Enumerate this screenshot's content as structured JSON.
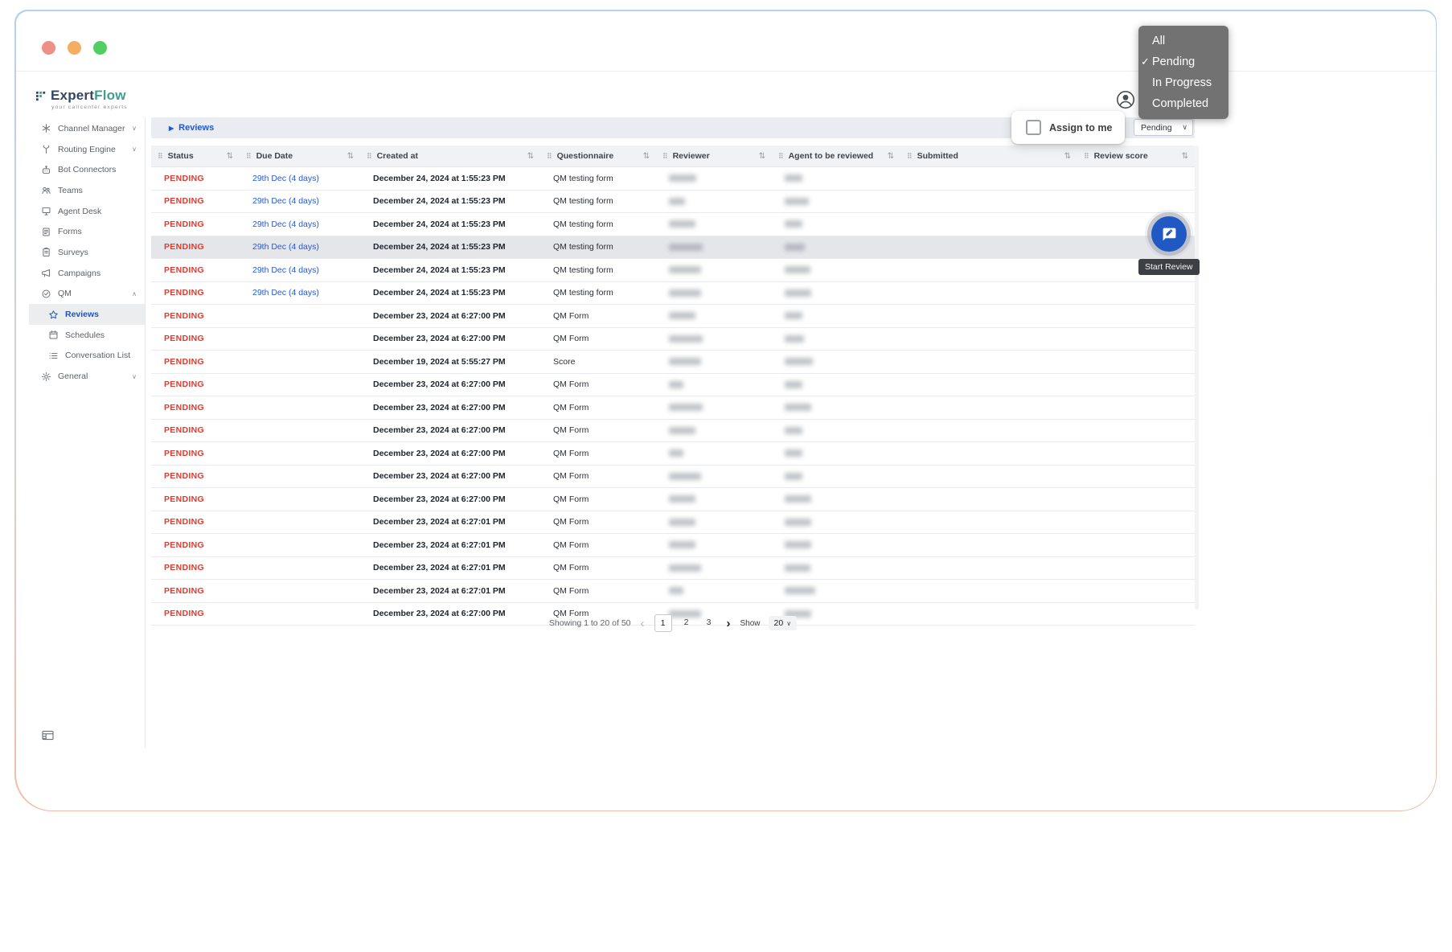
{
  "window": {
    "traffic_lights": [
      "close",
      "minimize",
      "zoom"
    ]
  },
  "brand": {
    "name_part1": "Expert",
    "name_part2": "Flow",
    "tagline": "your callcenter experts"
  },
  "sidebar": {
    "items": [
      {
        "label": "Channel Manager",
        "icon": "channel-manager",
        "chevron": "down"
      },
      {
        "label": "Routing Engine",
        "icon": "routing-engine",
        "chevron": "down"
      },
      {
        "label": "Bot Connectors",
        "icon": "bot-connectors"
      },
      {
        "label": "Teams",
        "icon": "teams"
      },
      {
        "label": "Agent Desk",
        "icon": "agent-desk"
      },
      {
        "label": "Forms",
        "icon": "forms"
      },
      {
        "label": "Surveys",
        "icon": "surveys"
      },
      {
        "label": "Campaigns",
        "icon": "campaigns"
      },
      {
        "label": "QM",
        "icon": "qm",
        "chevron": "up"
      },
      {
        "label": "Reviews",
        "icon": "reviews",
        "child": true,
        "active": true
      },
      {
        "label": "Schedules",
        "icon": "schedules",
        "child": true
      },
      {
        "label": "Conversation List",
        "icon": "conversation-list",
        "child": true
      },
      {
        "label": "General",
        "icon": "general",
        "chevron": "down"
      }
    ]
  },
  "toolbar": {
    "breadcrumb": "Reviews",
    "assign_to_me_label": "Assign to me",
    "status_filter_value": "Pending"
  },
  "filter_menu": {
    "items": [
      {
        "label": "All",
        "checked": false
      },
      {
        "label": "Pending",
        "checked": true
      },
      {
        "label": "In Progress",
        "checked": false
      },
      {
        "label": "Completed",
        "checked": false
      }
    ]
  },
  "table": {
    "columns": [
      "Status",
      "Due Date",
      "Created at",
      "Questionnaire",
      "Reviewer",
      "Agent to be reviewed",
      "Submitted",
      "Review score"
    ],
    "rows": [
      {
        "status": "PENDING",
        "due": "29th Dec (4 days)",
        "created": "December 24, 2024 at 1:55:23 PM",
        "form": "QM testing form",
        "reviewer_w": 34,
        "agent_w": 22
      },
      {
        "status": "PENDING",
        "due": "29th Dec (4 days)",
        "created": "December 24, 2024 at 1:55:23 PM",
        "form": "QM testing form",
        "reviewer_w": 20,
        "agent_w": 30
      },
      {
        "status": "PENDING",
        "due": "29th Dec (4 days)",
        "created": "December 24, 2024 at 1:55:23 PM",
        "form": "QM testing form",
        "reviewer_w": 33,
        "agent_w": 22
      },
      {
        "status": "PENDING",
        "due": "29th Dec (4 days)",
        "created": "December 24, 2024 at 1:55:23 PM",
        "form": "QM testing form",
        "reviewer_w": 42,
        "agent_w": 25,
        "highlighted": true
      },
      {
        "status": "PENDING",
        "due": "29th Dec (4 days)",
        "created": "December 24, 2024 at 1:55:23 PM",
        "form": "QM testing form",
        "reviewer_w": 40,
        "agent_w": 32
      },
      {
        "status": "PENDING",
        "due": "29th Dec (4 days)",
        "created": "December 24, 2024 at 1:55:23 PM",
        "form": "QM testing form",
        "reviewer_w": 40,
        "agent_w": 33
      },
      {
        "status": "PENDING",
        "due": "",
        "created": "December 23, 2024 at 6:27:00 PM",
        "form": "QM Form",
        "reviewer_w": 33,
        "agent_w": 22
      },
      {
        "status": "PENDING",
        "due": "",
        "created": "December 23, 2024 at 6:27:00 PM",
        "form": "QM Form",
        "reviewer_w": 42,
        "agent_w": 24
      },
      {
        "status": "PENDING",
        "due": "",
        "created": "December 19, 2024 at 5:55:27 PM",
        "form": "Score",
        "reviewer_w": 40,
        "agent_w": 35
      },
      {
        "status": "PENDING",
        "due": "",
        "created": "December 23, 2024 at 6:27:00 PM",
        "form": "QM Form",
        "reviewer_w": 18,
        "agent_w": 22
      },
      {
        "status": "PENDING",
        "due": "",
        "created": "December 23, 2024 at 6:27:00 PM",
        "form": "QM Form",
        "reviewer_w": 42,
        "agent_w": 33
      },
      {
        "status": "PENDING",
        "due": "",
        "created": "December 23, 2024 at 6:27:00 PM",
        "form": "QM Form",
        "reviewer_w": 33,
        "agent_w": 22
      },
      {
        "status": "PENDING",
        "due": "",
        "created": "December 23, 2024 at 6:27:00 PM",
        "form": "QM Form",
        "reviewer_w": 18,
        "agent_w": 22
      },
      {
        "status": "PENDING",
        "due": "",
        "created": "December 23, 2024 at 6:27:00 PM",
        "form": "QM Form",
        "reviewer_w": 40,
        "agent_w": 22
      },
      {
        "status": "PENDING",
        "due": "",
        "created": "December 23, 2024 at 6:27:00 PM",
        "form": "QM Form",
        "reviewer_w": 33,
        "agent_w": 33
      },
      {
        "status": "PENDING",
        "due": "",
        "created": "December 23, 2024 at 6:27:01 PM",
        "form": "QM Form",
        "reviewer_w": 33,
        "agent_w": 33
      },
      {
        "status": "PENDING",
        "due": "",
        "created": "December 23, 2024 at 6:27:01 PM",
        "form": "QM Form",
        "reviewer_w": 33,
        "agent_w": 33
      },
      {
        "status": "PENDING",
        "due": "",
        "created": "December 23, 2024 at 6:27:01 PM",
        "form": "QM Form",
        "reviewer_w": 40,
        "agent_w": 32
      },
      {
        "status": "PENDING",
        "due": "",
        "created": "December 23, 2024 at 6:27:01 PM",
        "form": "QM Form",
        "reviewer_w": 18,
        "agent_w": 38
      },
      {
        "status": "PENDING",
        "due": "",
        "created": "December 23, 2024 at 6:27:00 PM",
        "form": "QM Form",
        "reviewer_w": 40,
        "agent_w": 33
      }
    ]
  },
  "pagination": {
    "summary": "Showing 1 to 20 of 50",
    "pages": [
      "1",
      "2",
      "3"
    ],
    "active_page": "1",
    "show_label": "Show",
    "page_size": "20"
  },
  "floating": {
    "tooltip": "Start Review"
  }
}
